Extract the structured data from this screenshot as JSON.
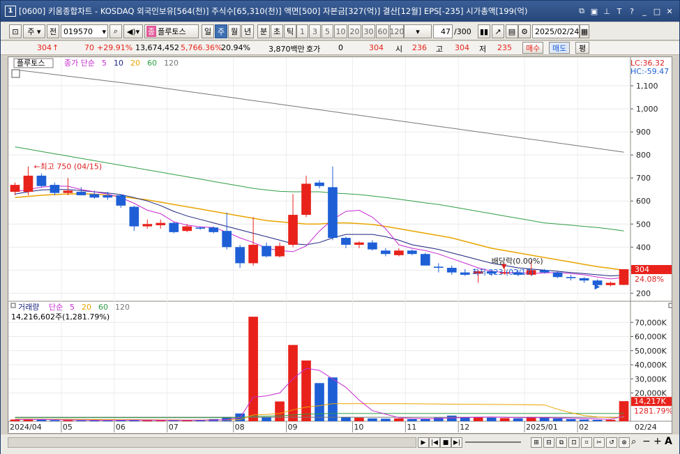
{
  "window": {
    "number": "1",
    "title": "[0600] 키움종합차트 - KOSDAQ 외국인보유[564(천)] 주식수[65,310(천)] 액면[500] 자본금[327(억)] 결산[12월] EPS[-235] 시가총액[199(억)"
  },
  "toolbar": {
    "type_label": "주",
    "prev_label": "전",
    "code": "019570",
    "stock_badge": "종",
    "stock_name": "플루토스",
    "periods": [
      "일",
      "주",
      "월",
      "년",
      "분",
      "초",
      "틱"
    ],
    "selected_period": "주",
    "intervals": [
      "1",
      "3",
      "5",
      "10",
      "20",
      "30",
      "60",
      "120"
    ],
    "count": "47",
    "count_max": "/300",
    "date": "2025/02/24"
  },
  "quote": {
    "price": "304",
    "change": "70",
    "change_pct": "+29.91%",
    "volume": "13,674,452",
    "volume_pct": "5,766.36%",
    "turnover": "20.94%",
    "amount": "3,870백만",
    "hoga_label": "호가",
    "hoga_value": "0",
    "hoga_price": "304",
    "open_label": "시",
    "open": "236",
    "high_label": "고",
    "high": "304",
    "low_label": "저",
    "low": "235",
    "buy_label": "매수",
    "sell_label": "매도",
    "avg_label": "평"
  },
  "price_panel": {
    "name_tag": "플루토스",
    "ma_label": "종가 단순",
    "ma_periods": [
      "5",
      "10",
      "20",
      "60",
      "120"
    ],
    "lc": "LC:36.32",
    "hc": "HC:-59.47",
    "high_annotation": "최고 750 (04/15)",
    "low_annotation": "최저 223 (02/17)",
    "dividend_annotation": "배당락(0.00%)",
    "current_price": "304",
    "current_pct": "24.08%"
  },
  "volume_panel": {
    "label": "거래량",
    "ma_label": "단순",
    "ma_periods": [
      "5",
      "20",
      "60",
      "120"
    ],
    "summary": "14,216,602주(1,281.79%)",
    "current_volume": "14,217K",
    "current_pct": "1281.79%"
  },
  "colors": {
    "up": "#e8221b",
    "down": "#1e5fd6",
    "ma5": "#c52ad0",
    "ma10": "#1a237e",
    "ma20": "#e8a400",
    "ma60": "#2e9e44",
    "ma120": "#777777"
  },
  "chart_data": {
    "type": "candlestick",
    "price_axis": {
      "ticks": [
        200,
        300,
        400,
        500,
        600,
        700,
        800,
        900,
        1000,
        1100
      ],
      "labels": [
        "200",
        "300",
        "400",
        "500",
        "600",
        "700",
        "800",
        "900",
        "1,000",
        "1,100"
      ]
    },
    "volume_axis": {
      "ticks": [
        20000,
        30000,
        40000,
        50000,
        60000,
        70000
      ],
      "labels": [
        "20,000K",
        "30,000K",
        "40,000K",
        "50,000K",
        "60,000K",
        "70,000K"
      ]
    },
    "x_labels": [
      {
        "index": 0,
        "text": "2024/04"
      },
      {
        "index": 4,
        "text": "05"
      },
      {
        "index": 8,
        "text": "06"
      },
      {
        "index": 12,
        "text": "07"
      },
      {
        "index": 17,
        "text": "08"
      },
      {
        "index": 21,
        "text": "09"
      },
      {
        "index": 26,
        "text": "10"
      },
      {
        "index": 30,
        "text": "11"
      },
      {
        "index": 34,
        "text": "12"
      },
      {
        "index": 39,
        "text": "2025/01"
      },
      {
        "index": 43,
        "text": "02"
      }
    ],
    "x_end_label": "02/24",
    "candles": [
      {
        "o": 640,
        "h": 680,
        "l": 625,
        "c": 670
      },
      {
        "o": 640,
        "h": 750,
        "l": 625,
        "c": 710
      },
      {
        "o": 710,
        "h": 720,
        "l": 660,
        "c": 665
      },
      {
        "o": 670,
        "h": 680,
        "l": 625,
        "c": 635
      },
      {
        "o": 635,
        "h": 700,
        "l": 625,
        "c": 645
      },
      {
        "o": 640,
        "h": 660,
        "l": 625,
        "c": 625
      },
      {
        "o": 630,
        "h": 645,
        "l": 610,
        "c": 615
      },
      {
        "o": 625,
        "h": 640,
        "l": 605,
        "c": 615
      },
      {
        "o": 625,
        "h": 630,
        "l": 570,
        "c": 580
      },
      {
        "o": 575,
        "h": 580,
        "l": 470,
        "c": 490
      },
      {
        "o": 490,
        "h": 520,
        "l": 480,
        "c": 500
      },
      {
        "o": 495,
        "h": 520,
        "l": 480,
        "c": 505
      },
      {
        "o": 505,
        "h": 510,
        "l": 460,
        "c": 465
      },
      {
        "o": 470,
        "h": 500,
        "l": 465,
        "c": 490
      },
      {
        "o": 485,
        "h": 490,
        "l": 475,
        "c": 480
      },
      {
        "o": 485,
        "h": 490,
        "l": 460,
        "c": 465
      },
      {
        "o": 470,
        "h": 550,
        "l": 390,
        "c": 400
      },
      {
        "o": 400,
        "h": 410,
        "l": 310,
        "c": 330
      },
      {
        "o": 330,
        "h": 530,
        "l": 320,
        "c": 410
      },
      {
        "o": 405,
        "h": 420,
        "l": 355,
        "c": 360
      },
      {
        "o": 360,
        "h": 420,
        "l": 355,
        "c": 405
      },
      {
        "o": 410,
        "h": 630,
        "l": 400,
        "c": 540
      },
      {
        "o": 540,
        "h": 710,
        "l": 530,
        "c": 675
      },
      {
        "o": 680,
        "h": 690,
        "l": 655,
        "c": 665
      },
      {
        "o": 660,
        "h": 750,
        "l": 430,
        "c": 440
      },
      {
        "o": 440,
        "h": 445,
        "l": 395,
        "c": 410
      },
      {
        "o": 410,
        "h": 425,
        "l": 395,
        "c": 420
      },
      {
        "o": 420,
        "h": 430,
        "l": 385,
        "c": 390
      },
      {
        "o": 385,
        "h": 395,
        "l": 360,
        "c": 370
      },
      {
        "o": 365,
        "h": 395,
        "l": 360,
        "c": 385
      },
      {
        "o": 385,
        "h": 390,
        "l": 365,
        "c": 370
      },
      {
        "o": 370,
        "h": 375,
        "l": 320,
        "c": 320
      },
      {
        "o": 315,
        "h": 330,
        "l": 290,
        "c": 310
      },
      {
        "o": 310,
        "h": 320,
        "l": 280,
        "c": 290
      },
      {
        "o": 290,
        "h": 305,
        "l": 275,
        "c": 280
      },
      {
        "o": 285,
        "h": 300,
        "l": 245,
        "c": 295
      },
      {
        "o": 295,
        "h": 300,
        "l": 275,
        "c": 285
      },
      {
        "o": 285,
        "h": 305,
        "l": 280,
        "c": 290
      },
      {
        "o": 290,
        "h": 300,
        "l": 275,
        "c": 280
      },
      {
        "o": 280,
        "h": 340,
        "l": 275,
        "c": 300
      },
      {
        "o": 300,
        "h": 305,
        "l": 285,
        "c": 290
      },
      {
        "o": 290,
        "h": 295,
        "l": 265,
        "c": 270
      },
      {
        "o": 270,
        "h": 280,
        "l": 255,
        "c": 265
      },
      {
        "o": 265,
        "h": 270,
        "l": 245,
        "c": 255
      },
      {
        "o": 255,
        "h": 260,
        "l": 223,
        "c": 235
      },
      {
        "o": 235,
        "h": 250,
        "l": 230,
        "c": 245
      },
      {
        "o": 236,
        "h": 304,
        "l": 235,
        "c": 304
      }
    ],
    "ma5": [
      640,
      650,
      660,
      665,
      664,
      650,
      640,
      630,
      615,
      590,
      560,
      545,
      510,
      495,
      488,
      485,
      465,
      440,
      420,
      395,
      385,
      380,
      405,
      470,
      520,
      555,
      560,
      530,
      480,
      410,
      395,
      385,
      370,
      350,
      330,
      310,
      295,
      290,
      290,
      285,
      288,
      290,
      285,
      280,
      270,
      262,
      268
    ],
    "ma10": [
      630,
      640,
      648,
      650,
      650,
      645,
      640,
      635,
      628,
      615,
      600,
      580,
      555,
      535,
      520,
      505,
      490,
      475,
      460,
      445,
      430,
      415,
      410,
      420,
      440,
      455,
      455,
      455,
      445,
      430,
      410,
      400,
      390,
      375,
      360,
      345,
      330,
      320,
      310,
      305,
      300,
      295,
      290,
      285,
      280,
      275,
      278
    ],
    "ma20": [
      615,
      620,
      625,
      628,
      630,
      632,
      630,
      625,
      620,
      612,
      605,
      595,
      585,
      575,
      565,
      555,
      545,
      535,
      525,
      515,
      510,
      505,
      500,
      500,
      505,
      505,
      502,
      498,
      490,
      480,
      470,
      460,
      450,
      440,
      425,
      410,
      395,
      385,
      375,
      365,
      355,
      345,
      335,
      325,
      315,
      308,
      300
    ],
    "ma60": [
      835,
      825,
      815,
      805,
      795,
      785,
      775,
      765,
      755,
      745,
      735,
      725,
      715,
      705,
      695,
      685,
      675,
      665,
      655,
      648,
      642,
      640,
      640,
      640,
      635,
      632,
      628,
      622,
      615,
      608,
      600,
      592,
      585,
      575,
      565,
      555,
      545,
      535,
      525,
      515,
      505,
      500,
      495,
      490,
      485,
      478,
      470
    ],
    "ma120": [
      1170,
      1163,
      1156,
      1149,
      1142,
      1135,
      1128,
      1121,
      1114,
      1107,
      1100,
      1092,
      1084,
      1076,
      1068,
      1060,
      1052,
      1044,
      1036,
      1028,
      1020,
      1012,
      1004,
      996,
      988,
      980,
      972,
      964,
      956,
      948,
      940,
      932,
      924,
      916,
      908,
      900,
      892,
      884,
      876,
      868,
      860,
      852,
      844,
      836,
      828,
      820,
      812
    ],
    "volumes": [
      1200,
      1500,
      1000,
      800,
      700,
      600,
      500,
      600,
      1200,
      900,
      700,
      500,
      600,
      800,
      1000,
      1500,
      3000,
      5500,
      74000,
      3000,
      14000,
      54000,
      43000,
      27000,
      31000,
      3000,
      2500,
      2000,
      1800,
      2000,
      1500,
      1500,
      2500,
      4000,
      2500,
      3000,
      2500,
      2200,
      2000,
      3000,
      2500,
      2000,
      1500,
      1200,
      1000,
      1000,
      14217
    ],
    "vol_ma5": [
      1200,
      1300,
      1250,
      1100,
      1000,
      900,
      750,
      700,
      750,
      800,
      800,
      750,
      700,
      700,
      750,
      850,
      1200,
      2300,
      17000,
      18000,
      20000,
      30000,
      37500,
      36000,
      30000,
      24000,
      15000,
      7500,
      5000,
      2500,
      2000,
      1800,
      1900,
      2300,
      2600,
      2800,
      3000,
      2800,
      2500,
      2600,
      2500,
      2300,
      2100,
      1900,
      1600,
      1400,
      3500
    ],
    "vol_ma20": [
      1500,
      1500,
      1450,
      1400,
      1350,
      1300,
      1250,
      1200,
      1150,
      1100,
      1050,
      1000,
      950,
      900,
      900,
      950,
      1000,
      1100,
      4500,
      4800,
      5500,
      8000,
      10000,
      11000,
      12500,
      12500,
      12500,
      12500,
      12500,
      12500,
      12400,
      12300,
      12200,
      12100,
      12000,
      12000,
      11900,
      11800,
      11700,
      11600,
      11500,
      8500,
      6000,
      4000,
      3000,
      2500,
      3000
    ],
    "vol_ma60": [
      2500,
      2500,
      2500,
      2500,
      2500,
      2500,
      2500,
      2500,
      2500,
      2500,
      2500,
      2500,
      2500,
      2500,
      2500,
      2500,
      2500,
      2500,
      3500,
      3500,
      3800,
      4500,
      5000,
      5200,
      5500,
      5500,
      5500,
      5500,
      5500,
      5500,
      5500,
      5500,
      5500,
      5500,
      5500,
      5500,
      5500,
      5500,
      5500,
      5500,
      5500,
      5500,
      5500,
      5500,
      5500,
      5500,
      5500
    ],
    "vol_ma120": [
      2800,
      2800,
      2800,
      2800,
      2800,
      2800,
      2800,
      2800,
      2800,
      2800,
      2800,
      2800,
      2800,
      2800,
      2800,
      2800,
      2800,
      2800,
      2800,
      2800,
      2800,
      2800,
      2800,
      2800,
      2800,
      2800,
      2800,
      2800,
      2800,
      2800,
      2800,
      2800,
      2800,
      2800,
      2800,
      2800,
      2800,
      2800,
      2800,
      2800,
      2800,
      2800,
      2800,
      2800,
      2800,
      2800,
      2800
    ],
    "last_index_marker": {
      "index": 46,
      "price": 304
    }
  },
  "navigation": {
    "zoom_minus": "−",
    "zoom_plus": "+",
    "font_a": "A"
  }
}
